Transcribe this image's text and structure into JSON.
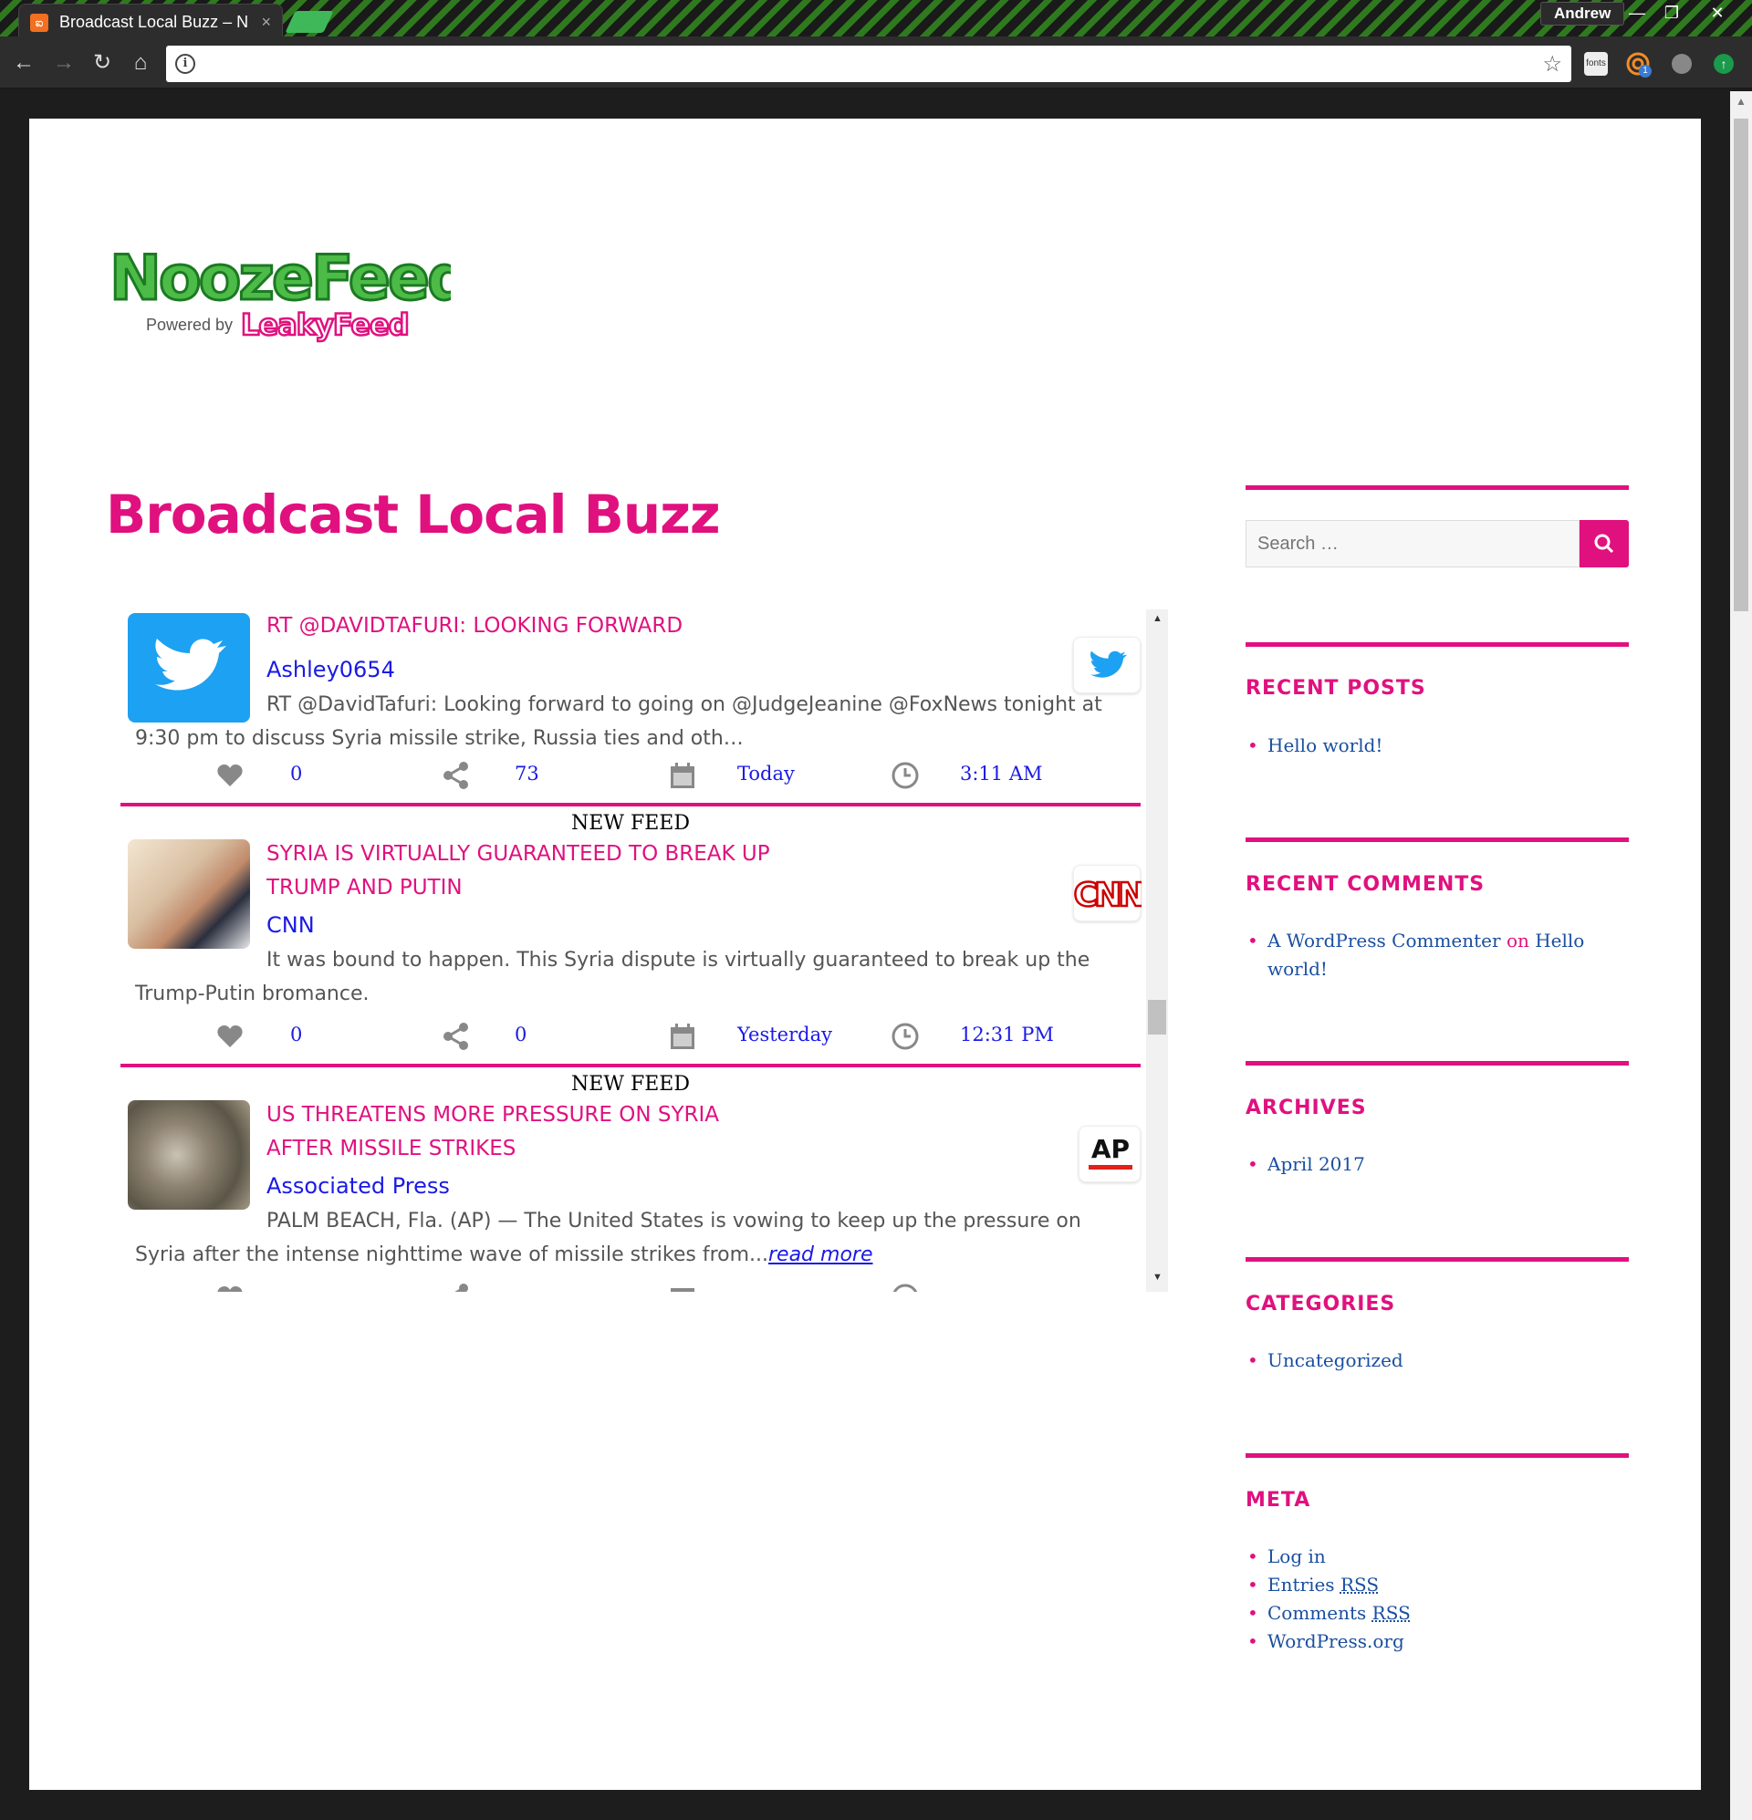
{
  "browser": {
    "tab_title": "Broadcast Local Buzz – N",
    "tab_close": "×",
    "profile_name": "Andrew",
    "ext_fonts_label": "fonts",
    "ext_badge": "1"
  },
  "page": {
    "title": "Broadcast Local Buzz",
    "logo_main": "NoozeFeed",
    "logo_powered": "Powered by",
    "logo_brand": "LeakyFeed"
  },
  "feed": {
    "items": [
      {
        "headline": "RT @DAVIDTAFURI: LOOKING FORWARD",
        "source": "Ashley0654",
        "excerpt": "RT @DavidTafuri: Looking forward to going on @JudgeJeanine @FoxNews tonight at 9:30 pm to discuss Syria missile strike, Russia ties and oth…",
        "likes": "0",
        "shares": "73",
        "date": "Today",
        "time": "3:11 AM",
        "logo": "twitter-icon"
      },
      {
        "label": "NEW FEED",
        "headline": "SYRIA IS VIRTUALLY GUARANTEED TO BREAK UP TRUMP AND PUTIN",
        "source": "CNN",
        "excerpt": "It was bound to happen. This Syria dispute is virtually guaranteed to break up the Trump-Putin bromance.",
        "likes": "0",
        "shares": "0",
        "date": "Yesterday",
        "time": "12:31 PM",
        "logo_text": "CNN"
      },
      {
        "label": "NEW FEED",
        "headline": "US THREATENS MORE PRESSURE ON SYRIA AFTER MISSILE STRIKES",
        "source": "Associated Press",
        "excerpt": "PALM BEACH, Fla. (AP) — The United States is vowing to keep up the pressure on Syria after the intense nighttime wave of missile strikes from...",
        "read_more": "read more",
        "logo_text": "AP"
      }
    ]
  },
  "sidebar": {
    "search_placeholder": "Search …",
    "recent_posts": {
      "title": "RECENT POSTS",
      "items": [
        "Hello world!"
      ]
    },
    "recent_comments": {
      "title": "RECENT COMMENTS",
      "author": "A WordPress Commenter",
      "on": "on",
      "post": "Hello world!"
    },
    "archives": {
      "title": "ARCHIVES",
      "items": [
        "April 2017"
      ]
    },
    "categories": {
      "title": "CATEGORIES",
      "items": [
        "Uncategorized"
      ]
    },
    "meta": {
      "title": "META",
      "login": "Log in",
      "entries": "Entries",
      "comments": "Comments",
      "rss": "RSS",
      "wordpress": "WordPress.org"
    }
  },
  "colors": {
    "accent": "#e0117f",
    "link": "#1a1ae6",
    "sidebar_link": "#1a4fa0"
  }
}
